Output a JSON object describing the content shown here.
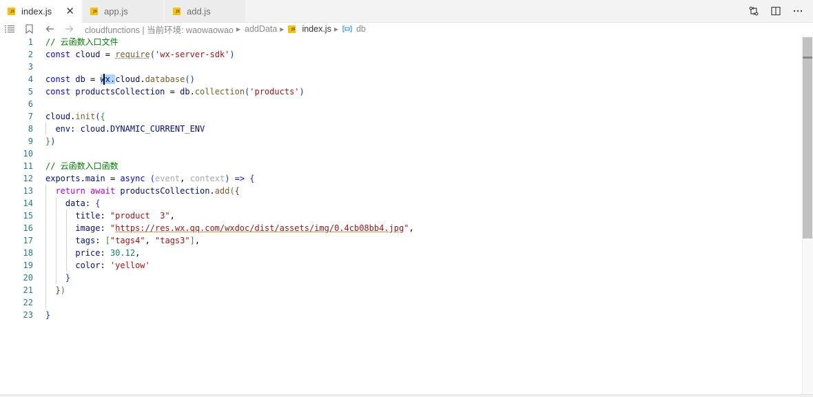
{
  "tabs": [
    {
      "label": "index.js",
      "icon": "js-file-icon",
      "active": true
    },
    {
      "label": "app.js",
      "icon": "js-file-icon",
      "active": false
    },
    {
      "label": "add.js",
      "icon": "js-file-icon",
      "active": false
    }
  ],
  "tab_close_glyph": "✕",
  "js_icon_text": "JS",
  "editor_actions": [
    "compare-changes-icon",
    "split-editor-icon",
    "more-actions-icon"
  ],
  "breadcrumbs": {
    "path_text": "cloudfunctions | 当前环境: waowaowao",
    "folder": "addData",
    "file": "index.js",
    "symbol": "db"
  },
  "line_numbers": [
    "1",
    "2",
    "3",
    "4",
    "5",
    "6",
    "7",
    "8",
    "9",
    "10",
    "11",
    "12",
    "13",
    "14",
    "15",
    "16",
    "17",
    "18",
    "19",
    "20",
    "21",
    "22",
    "23"
  ],
  "code": {
    "l1": {
      "comment": "// 云函数入口文件"
    },
    "l2": {
      "kw": "const",
      "name": "cloud",
      "eq": "=",
      "fn": "require",
      "open": "(",
      "str": "'wx-server-sdk'",
      "close": ")"
    },
    "l4": {
      "kw": "const",
      "name": "db",
      "eq": "=",
      "sel": "wx.",
      "obj": "cloud",
      "dot": ".",
      "fn": "database",
      "parens": "()"
    },
    "l5": {
      "kw": "const",
      "name": "productsCollection",
      "eq": "=",
      "obj": "db",
      "dot": ".",
      "fn": "collection",
      "open": "(",
      "str": "'products'",
      "close": ")"
    },
    "l7": {
      "obj": "cloud",
      "dot": ".",
      "fn": "init",
      "open": "(",
      "brace": "{"
    },
    "l8": {
      "key": "env",
      "colon": ":",
      "obj": "cloud",
      "dot": ".",
      "prop": "DYNAMIC_CURRENT_ENV"
    },
    "l9": {
      "brace": "}",
      "close": ")"
    },
    "l11": {
      "comment": "// 云函数入口函数"
    },
    "l12": {
      "obj": "exports",
      "dot": ".",
      "prop": "main",
      "eq": "=",
      "kw": "async",
      "open": "(",
      "p1": "event",
      "comma": ",",
      "p2": "context",
      "close": ")",
      "arrow": "=>",
      "brace": "{"
    },
    "l13": {
      "ret": "return",
      "aw": "await",
      "obj": "productsCollection",
      "dot": ".",
      "fn": "add",
      "open": "(",
      "brace": "{"
    },
    "l14": {
      "key": "data",
      "colon": ":",
      "brace": "{"
    },
    "l15": {
      "key": "title",
      "colon": ":",
      "str": "\"product  3\"",
      "comma": ","
    },
    "l16": {
      "key": "image",
      "colon": ":",
      "q": "\"",
      "url": "https://res.wx.qq.com/wxdoc/dist/assets/img/0.4cb08bb4.jpg",
      "comma": ","
    },
    "l17": {
      "key": "tags",
      "colon": ":",
      "open": "[",
      "s1": "\"tags4\"",
      "comma": ",",
      "s2": "\"tags3\"",
      "close": "]",
      "comma2": ","
    },
    "l18": {
      "key": "price",
      "colon": ":",
      "num": "30.12",
      "comma": ","
    },
    "l19": {
      "key": "color",
      "colon": ":",
      "str": "'yellow'"
    },
    "l20": {
      "brace": "}"
    },
    "l21": {
      "brace": "}",
      "close": ")"
    },
    "l23": {
      "brace": "}"
    }
  },
  "colors": {
    "comment": "#008000",
    "keyword": "#0000ff",
    "control": "#af00db",
    "variable": "#001080",
    "function": "#795e26",
    "string": "#a31515",
    "number": "#098658",
    "selection": "#add6ff",
    "line_number": "#237893",
    "js_icon": "#f4c20d"
  }
}
